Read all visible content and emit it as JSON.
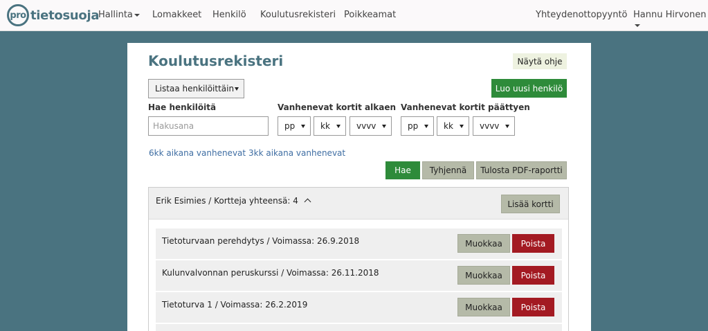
{
  "nav": {
    "logo_pro": "pro",
    "logo_name": "tietosuoja",
    "items": [
      {
        "label": "Hallinta",
        "dropdown": true
      },
      {
        "label": "Lomakkeet",
        "dropdown": false
      },
      {
        "label": "Henkilö",
        "dropdown": false
      },
      {
        "label": "Koulutusrekisteri",
        "dropdown": false
      },
      {
        "label": "Poikkeamat",
        "dropdown": false
      }
    ],
    "contact": "Yhteydenottopyyntö",
    "user": "Hannu Hirvonen"
  },
  "page": {
    "title": "Koulutusrekisteri",
    "help_button": "Näytä ohje",
    "list_select": "Listaa henkilöittäin",
    "new_person_button": "Luo uusi henkilö",
    "search_label": "Hae henkilöitä",
    "search_placeholder": "Hakusana",
    "expiring_from_label": "Vanhenevat kortit alkaen",
    "expiring_to_label": "Vanhenevat kortit päättyen",
    "date_selects": {
      "day": "pp",
      "month": "kk",
      "year": "vvvv"
    },
    "link_6kk": "6kk aikana vanhenevat",
    "link_3kk": "3kk aikana vanhenevat",
    "search_button": "Hae",
    "clear_button": "Tyhjennä",
    "pdf_button": "Tulosta PDF-raportti"
  },
  "person": {
    "title": "Erik Esimies / Kortteja yhteensä: 4",
    "add_card_button": "Lisää kortti",
    "edit_label": "Muokkaa",
    "delete_label": "Poista",
    "cards": [
      {
        "text": "Tietoturvaan perehdytys / Voimassa: 26.9.2018"
      },
      {
        "text": "Kulunvalvonnan peruskurssi / Voimassa: 26.11.2018"
      },
      {
        "text": "Tietoturva 1 / Voimassa: 26.2.2019"
      }
    ]
  },
  "colors": {
    "background": "#4a7380",
    "primary_green": "#2e8b3a",
    "danger_red": "#a31a22",
    "neutral_button": "#b5baa8"
  }
}
